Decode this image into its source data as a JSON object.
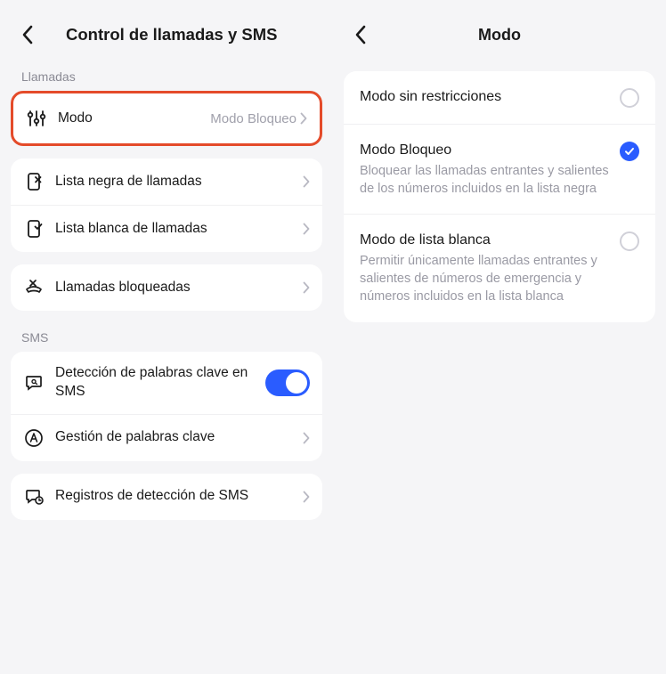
{
  "left": {
    "title": "Control de llamadas y SMS",
    "sections": {
      "calls_label": "Llamadas",
      "sms_label": "SMS"
    },
    "rows": {
      "modo": {
        "label": "Modo",
        "value": "Modo Bloqueo"
      },
      "blacklist": {
        "label": "Lista negra de llamadas"
      },
      "whitelist": {
        "label": "Lista blanca de llamadas"
      },
      "blocked": {
        "label": "Llamadas bloqueadas"
      },
      "keyword_detect": {
        "label": "Detección de palabras clave en SMS",
        "enabled": true
      },
      "keyword_manage": {
        "label": "Gestión de palabras clave"
      },
      "sms_logs": {
        "label": "Registros de detección de SMS"
      }
    }
  },
  "right": {
    "title": "Modo",
    "options": {
      "unrestricted": {
        "title": "Modo sin restricciones",
        "desc": "",
        "selected": false
      },
      "block": {
        "title": "Modo Bloqueo",
        "desc": "Bloquear las llamadas entrantes y salientes de los números incluidos en la lista negra",
        "selected": true
      },
      "whitelist": {
        "title": "Modo de lista blanca",
        "desc": "Permitir únicamente llamadas entrantes y salientes de números de emergencia y números incluidos en la lista blanca",
        "selected": false
      }
    }
  }
}
